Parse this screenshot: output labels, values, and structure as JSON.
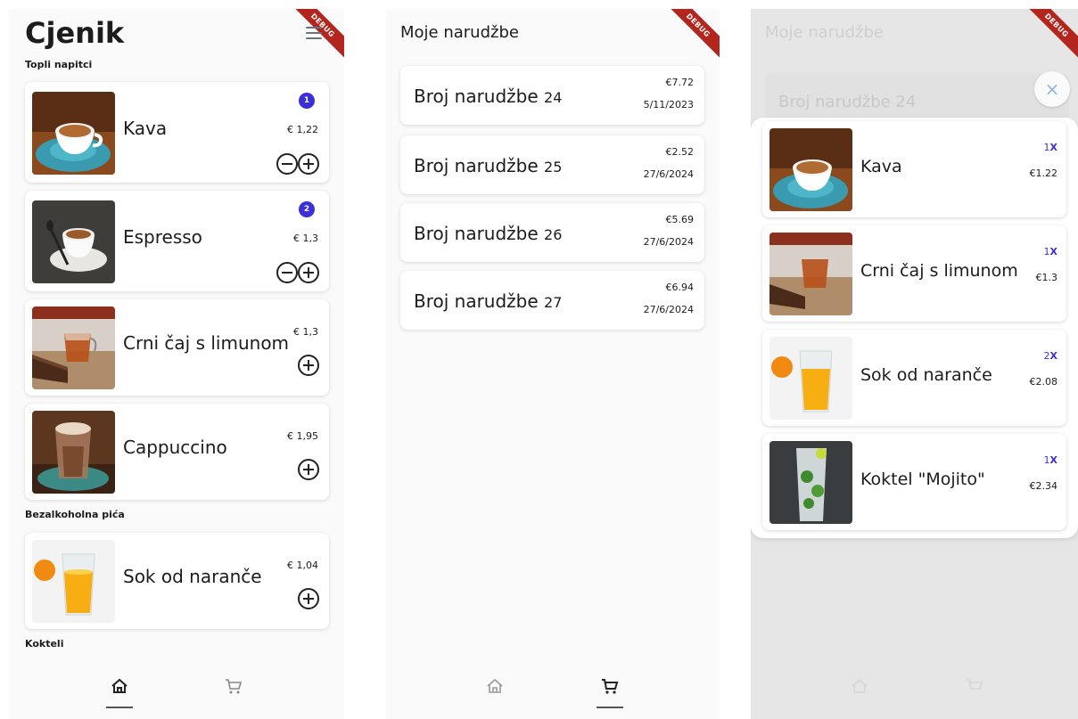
{
  "screen1": {
    "title": "Cjenik",
    "sections": [
      {
        "label": "Topli napitci",
        "items": [
          {
            "name": "Kava",
            "price": "€ 1,22",
            "badge": "1",
            "has_minus": true
          },
          {
            "name": "Espresso",
            "price": "€ 1,3",
            "badge": "2",
            "has_minus": true
          },
          {
            "name": "Crni čaj s limunom",
            "price": "€ 1,3",
            "badge": null,
            "has_minus": false
          },
          {
            "name": "Cappuccino",
            "price": "€ 1,95",
            "badge": null,
            "has_minus": false
          }
        ]
      },
      {
        "label": "Bezalkoholna pića",
        "items": [
          {
            "name": "Sok od naranče",
            "price": "€ 1,04",
            "badge": null,
            "has_minus": false
          }
        ]
      },
      {
        "label": "Kokteli",
        "items": []
      }
    ],
    "debug": "DEBUG"
  },
  "screen2": {
    "title": "Moje narudžbe",
    "orders": [
      {
        "label": "Broj narudžbe",
        "number": "24",
        "price": "€7.72",
        "date": "5/11/2023"
      },
      {
        "label": "Broj narudžbe",
        "number": "25",
        "price": "€2.52",
        "date": "27/6/2024"
      },
      {
        "label": "Broj narudžbe",
        "number": "26",
        "price": "€5.69",
        "date": "27/6/2024"
      },
      {
        "label": "Broj narudžbe",
        "number": "27",
        "price": "€6.94",
        "date": "27/6/2024"
      }
    ],
    "debug": "DEBUG"
  },
  "screen3": {
    "background_title": "Moje narudžbe",
    "background_order": "Broj narudžbe 24",
    "close_icon": "×",
    "items": [
      {
        "name": "Kava",
        "qty": "1",
        "qty_suffix": "X",
        "price": "€1.22"
      },
      {
        "name": "Crni čaj s limunom",
        "qty": "1",
        "qty_suffix": "X",
        "price": "€1.3"
      },
      {
        "name": "Sok od naranče",
        "qty": "2",
        "qty_suffix": "X",
        "price": "€2.08"
      },
      {
        "name": "Koktel \"Mojito\"",
        "qty": "1",
        "qty_suffix": "X",
        "price": "€2.34"
      }
    ],
    "debug": "DEBUG"
  },
  "nav": {
    "home_icon": "home-icon",
    "cart_icon": "cart-icon"
  },
  "colors": {
    "accent": "#3b30d6",
    "debug_ribbon": "#b3261e",
    "card": "#ffffff"
  }
}
